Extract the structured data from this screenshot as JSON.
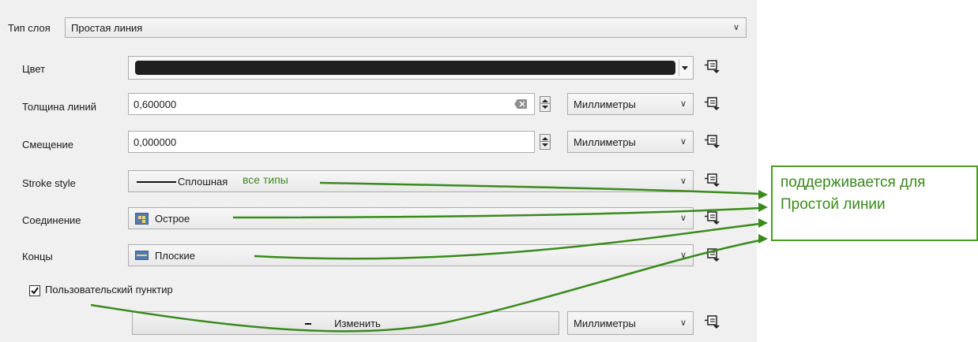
{
  "layer_type": {
    "label": "Тип слоя",
    "value": "Простая линия"
  },
  "color": {
    "label": "Цвет",
    "swatch": "#1f1f1f"
  },
  "stroke_width": {
    "label": "Толщина линий",
    "value": "0,600000",
    "unit": "Миллиметры"
  },
  "offset": {
    "label": "Смещение",
    "value": "0,000000",
    "unit": "Миллиметры"
  },
  "stroke_style": {
    "label": "Stroke style",
    "value": "Сплошная"
  },
  "join_style": {
    "label": "Соединение",
    "value": "Острое"
  },
  "cap_style": {
    "label": "Концы",
    "value": "Плоские"
  },
  "custom_dash": {
    "label": "Пользовательский пунктир",
    "checked": true,
    "button_label": "Изменить",
    "unit": "Миллиметры"
  },
  "annotation": {
    "inline_note": "все типы",
    "callout_line1": "поддерживается для",
    "callout_line2": "Простой линии",
    "color": "#3a8a1c"
  },
  "icons": [
    "data-defined-override-icon",
    "clear-icon",
    "spin-arrows-icon",
    "chevron-down-icon",
    "checkbox-checked-icon",
    "join-style-icon",
    "cap-style-icon",
    "dash-line-icon"
  ]
}
